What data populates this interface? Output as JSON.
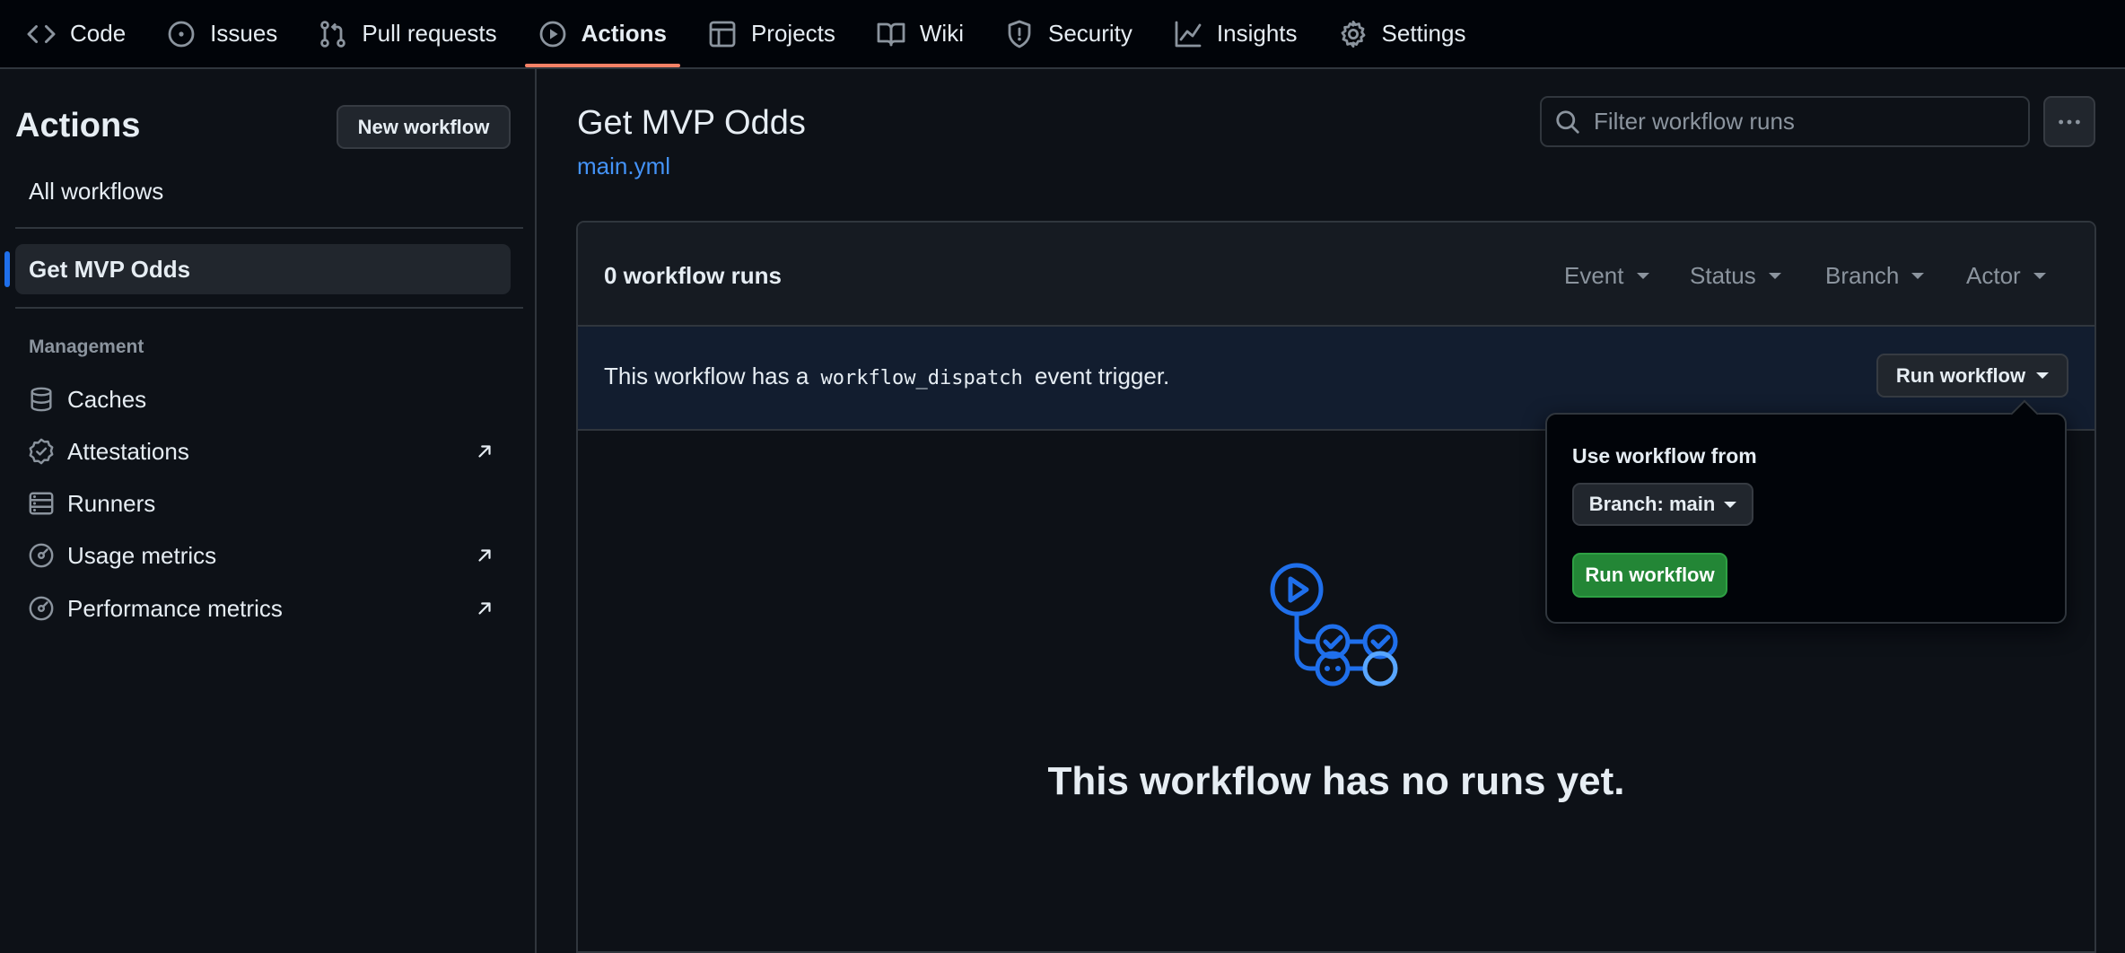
{
  "nav": {
    "tabs": [
      {
        "label": "Code",
        "icon": "code-icon"
      },
      {
        "label": "Issues",
        "icon": "issue-opened-icon"
      },
      {
        "label": "Pull requests",
        "icon": "git-pull-request-icon"
      },
      {
        "label": "Actions",
        "icon": "play-icon",
        "active": true
      },
      {
        "label": "Projects",
        "icon": "table-icon"
      },
      {
        "label": "Wiki",
        "icon": "book-icon"
      },
      {
        "label": "Security",
        "icon": "shield-icon"
      },
      {
        "label": "Insights",
        "icon": "graph-icon"
      },
      {
        "label": "Settings",
        "icon": "gear-icon"
      }
    ]
  },
  "sidebar": {
    "title": "Actions",
    "new_workflow_label": "New workflow",
    "all_workflows_label": "All workflows",
    "selected_workflow": "Get MVP Odds",
    "section_label": "Management",
    "items": [
      {
        "label": "Caches",
        "icon": "database-icon",
        "external": false
      },
      {
        "label": "Attestations",
        "icon": "verified-icon",
        "external": true
      },
      {
        "label": "Runners",
        "icon": "server-icon",
        "external": false
      },
      {
        "label": "Usage metrics",
        "icon": "meter-icon",
        "external": true
      },
      {
        "label": "Performance metrics",
        "icon": "meter-icon",
        "external": true
      }
    ]
  },
  "main": {
    "title": "Get MVP Odds",
    "file_link": "main.yml",
    "filter_placeholder": "Filter workflow runs",
    "runs_count": "0 workflow runs",
    "filters": [
      "Event",
      "Status",
      "Branch",
      "Actor"
    ],
    "dispatch": {
      "prefix": "This workflow has a",
      "code": "workflow_dispatch",
      "suffix": "event trigger."
    },
    "run_workflow_dropdown_label": "Run workflow",
    "empty_state": "This workflow has no runs yet."
  },
  "popover": {
    "label": "Use workflow from",
    "branch_button": "Branch: main",
    "run_button": "Run workflow"
  },
  "colors": {
    "accent_tab": "#f78166",
    "link": "#4493f8",
    "run_green": "#238636",
    "icon_blue": "#1f6feb"
  }
}
